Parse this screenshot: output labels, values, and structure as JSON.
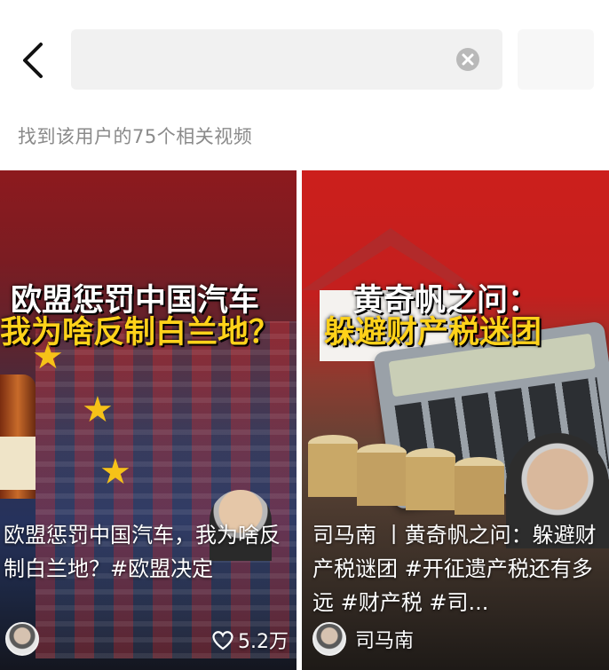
{
  "header": {
    "search_value": "",
    "result_text": "找到该用户的75个相关视频"
  },
  "videos": [
    {
      "headline_line1": "欧盟惩罚中国汽车",
      "headline_line2": "我为啥反制白兰地？",
      "description": "欧盟惩罚中国汽车，我为啥反制白兰地？#欧盟决定",
      "author": "",
      "likes": "5.2万"
    },
    {
      "headline_line1": "黄奇帆之问：",
      "headline_line2": "躲避财产税迷团",
      "description": "司马南 丨黄奇帆之问：躲避财产税谜团 #开征遗产税还有多远 #财产税 #司...",
      "author": "司马南"
    }
  ]
}
